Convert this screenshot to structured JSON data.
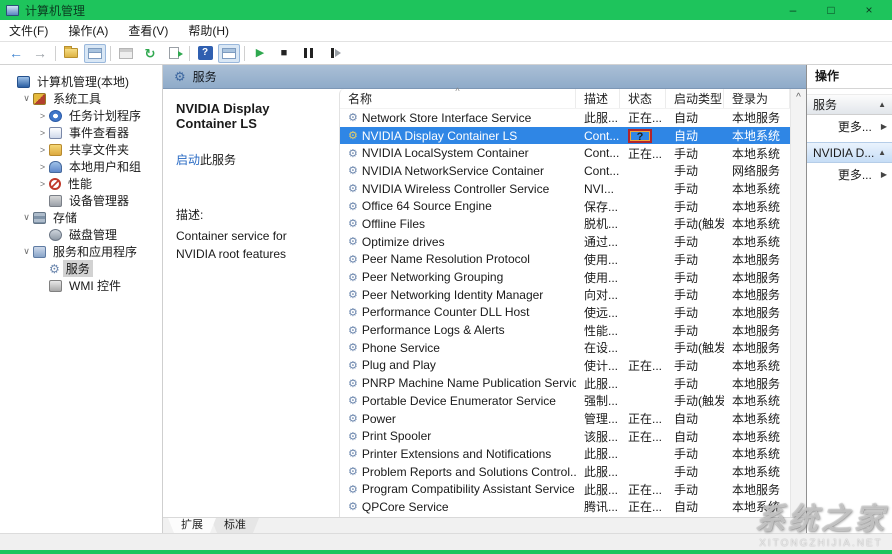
{
  "window": {
    "title": "计算机管理",
    "controls": {
      "minimize": "–",
      "maximize": "□",
      "close": "×"
    }
  },
  "menu": {
    "items": [
      {
        "key": "file",
        "label": "文件(F)"
      },
      {
        "key": "action",
        "label": "操作(A)"
      },
      {
        "key": "view",
        "label": "查看(V)"
      },
      {
        "key": "help",
        "label": "帮助(H)"
      }
    ]
  },
  "toolbar": {
    "buttons": [
      {
        "name": "back-button",
        "icon": "back"
      },
      {
        "name": "forward-button",
        "icon": "forward"
      },
      {
        "separator": true
      },
      {
        "name": "up-one-level-button",
        "icon": "folder-up"
      },
      {
        "name": "show-console-tree-button",
        "icon": "console-window",
        "pressed": true
      },
      {
        "separator": true
      },
      {
        "name": "properties-button-disabled",
        "icon": "window-gray"
      },
      {
        "name": "refresh-button",
        "icon": "refresh"
      },
      {
        "name": "export-list-button",
        "icon": "export"
      },
      {
        "separator": true
      },
      {
        "name": "help-button",
        "icon": "help"
      },
      {
        "name": "show-hide-action-pane-button",
        "icon": "pane-window",
        "pressed": true
      },
      {
        "separator": true
      },
      {
        "name": "start-service-button",
        "icon": "play"
      },
      {
        "name": "stop-service-button",
        "icon": "stop"
      },
      {
        "name": "pause-service-button",
        "icon": "pause"
      },
      {
        "name": "restart-service-button",
        "icon": "step"
      }
    ]
  },
  "tree": {
    "items": [
      {
        "level": 0,
        "expander": "",
        "icon": "computer",
        "label": "计算机管理(本地)"
      },
      {
        "level": 1,
        "expander": "v",
        "icon": "system-tools",
        "label": "系统工具"
      },
      {
        "level": 2,
        "expander": ">",
        "icon": "task-scheduler",
        "label": "任务计划程序"
      },
      {
        "level": 2,
        "expander": ">",
        "icon": "event-viewer",
        "label": "事件查看器"
      },
      {
        "level": 2,
        "expander": ">",
        "icon": "shared-folders",
        "label": "共享文件夹"
      },
      {
        "level": 2,
        "expander": ">",
        "icon": "local-users",
        "label": "本地用户和组"
      },
      {
        "level": 2,
        "expander": ">",
        "icon": "performance",
        "label": "性能"
      },
      {
        "level": 2,
        "expander": "",
        "icon": "device-manager",
        "label": "设备管理器"
      },
      {
        "level": 1,
        "expander": "v",
        "icon": "storage",
        "label": "存储"
      },
      {
        "level": 2,
        "expander": "",
        "icon": "disk-management",
        "label": "磁盘管理"
      },
      {
        "level": 1,
        "expander": "v",
        "icon": "services-apps",
        "label": "服务和应用程序"
      },
      {
        "level": 2,
        "expander": "",
        "icon": "services",
        "label": "服务",
        "selected": true
      },
      {
        "level": 2,
        "expander": "",
        "icon": "wmi",
        "label": "WMI 控件"
      }
    ]
  },
  "console": {
    "header_title": "服务",
    "detail": {
      "service_name": "NVIDIA Display Container LS",
      "start_link": "启动",
      "start_suffix": "此服务",
      "description_label": "描述:",
      "description": "Container service for NVIDIA root features"
    },
    "list": {
      "columns": [
        {
          "key": "name",
          "label": "名称",
          "sorted": true
        },
        {
          "key": "desc",
          "label": "描述"
        },
        {
          "key": "status",
          "label": "状态"
        },
        {
          "key": "startup",
          "label": "启动类型"
        },
        {
          "key": "logon",
          "label": "登录为"
        }
      ],
      "rows": [
        {
          "name": "Network Store Interface Service",
          "desc": "此服...",
          "status": "正在...",
          "startup": "自动",
          "logon": "本地服务"
        },
        {
          "name": "NVIDIA Display Container LS",
          "desc": "Cont...",
          "status": "",
          "startup": "自动",
          "logon": "本地系统",
          "selected": true,
          "annotated": true
        },
        {
          "name": "NVIDIA LocalSystem Container",
          "desc": "Cont...",
          "status": "正在...",
          "startup": "手动",
          "logon": "本地系统"
        },
        {
          "name": "NVIDIA NetworkService Container",
          "desc": "Cont...",
          "status": "",
          "startup": "手动",
          "logon": "网络服务"
        },
        {
          "name": "NVIDIA Wireless Controller Service",
          "desc": "NVI...",
          "status": "",
          "startup": "手动",
          "logon": "本地系统"
        },
        {
          "name": "Office 64 Source Engine",
          "desc": "保存...",
          "status": "",
          "startup": "手动",
          "logon": "本地系统"
        },
        {
          "name": "Offline Files",
          "desc": "脱机...",
          "status": "",
          "startup": "手动(触发...",
          "logon": "本地系统"
        },
        {
          "name": "Optimize drives",
          "desc": "通过...",
          "status": "",
          "startup": "手动",
          "logon": "本地系统"
        },
        {
          "name": "Peer Name Resolution Protocol",
          "desc": "使用...",
          "status": "",
          "startup": "手动",
          "logon": "本地服务"
        },
        {
          "name": "Peer Networking Grouping",
          "desc": "使用...",
          "status": "",
          "startup": "手动",
          "logon": "本地服务"
        },
        {
          "name": "Peer Networking Identity Manager",
          "desc": "向对...",
          "status": "",
          "startup": "手动",
          "logon": "本地服务"
        },
        {
          "name": "Performance Counter DLL Host",
          "desc": "使远...",
          "status": "",
          "startup": "手动",
          "logon": "本地服务"
        },
        {
          "name": "Performance Logs & Alerts",
          "desc": "性能...",
          "status": "",
          "startup": "手动",
          "logon": "本地服务"
        },
        {
          "name": "Phone Service",
          "desc": "在设...",
          "status": "",
          "startup": "手动(触发...",
          "logon": "本地服务"
        },
        {
          "name": "Plug and Play",
          "desc": "使计...",
          "status": "正在...",
          "startup": "手动",
          "logon": "本地系统"
        },
        {
          "name": "PNRP Machine Name Publication Service",
          "desc": "此服...",
          "status": "",
          "startup": "手动",
          "logon": "本地服务"
        },
        {
          "name": "Portable Device Enumerator Service",
          "desc": "强制...",
          "status": "",
          "startup": "手动(触发...",
          "logon": "本地系统"
        },
        {
          "name": "Power",
          "desc": "管理...",
          "status": "正在...",
          "startup": "自动",
          "logon": "本地系统"
        },
        {
          "name": "Print Spooler",
          "desc": "该服...",
          "status": "正在...",
          "startup": "自动",
          "logon": "本地系统"
        },
        {
          "name": "Printer Extensions and Notifications",
          "desc": "此服...",
          "status": "",
          "startup": "手动",
          "logon": "本地系统"
        },
        {
          "name": "Problem Reports and Solutions Control...",
          "desc": "此服...",
          "status": "",
          "startup": "手动",
          "logon": "本地系统"
        },
        {
          "name": "Program Compatibility Assistant Service",
          "desc": "此服...",
          "status": "正在...",
          "startup": "手动",
          "logon": "本地服务"
        },
        {
          "name": "QPCore Service",
          "desc": "腾讯...",
          "status": "正在...",
          "startup": "自动",
          "logon": "本地系统"
        }
      ]
    },
    "tabs": [
      {
        "key": "extended",
        "label": "扩展",
        "active": true
      },
      {
        "key": "standard",
        "label": "标准"
      }
    ]
  },
  "actions": {
    "title": "操作",
    "sections": [
      {
        "key": "services",
        "title": "服务",
        "highlight": false,
        "items": [
          {
            "label": "更多..."
          }
        ]
      },
      {
        "key": "nvidia",
        "title": "NVIDIA D...",
        "highlight": true,
        "items": [
          {
            "label": "更多..."
          }
        ]
      }
    ]
  },
  "annotation": {
    "glyph": "?",
    "border_color": "#b3252b",
    "inner_color": "#f0a63a"
  },
  "icons": {
    "glyphs": {
      "back": "←",
      "forward": "→",
      "refresh": "↻",
      "help": "?",
      "play": "▶",
      "stop": "■",
      "services": "⚙",
      "expanded": "∨",
      "collapsed": ">",
      "sort": "^",
      "scroll_up": "^",
      "collapse": "▲",
      "submenu": "▶"
    }
  },
  "watermark": {
    "title": "系统之家",
    "subtitle": "XITONGZHIJIA.NET"
  },
  "colors": {
    "titlebar": "#1ec45c",
    "selection": "#2f86e5",
    "console_header": "#8fabc9",
    "link": "#2a6bc4"
  }
}
